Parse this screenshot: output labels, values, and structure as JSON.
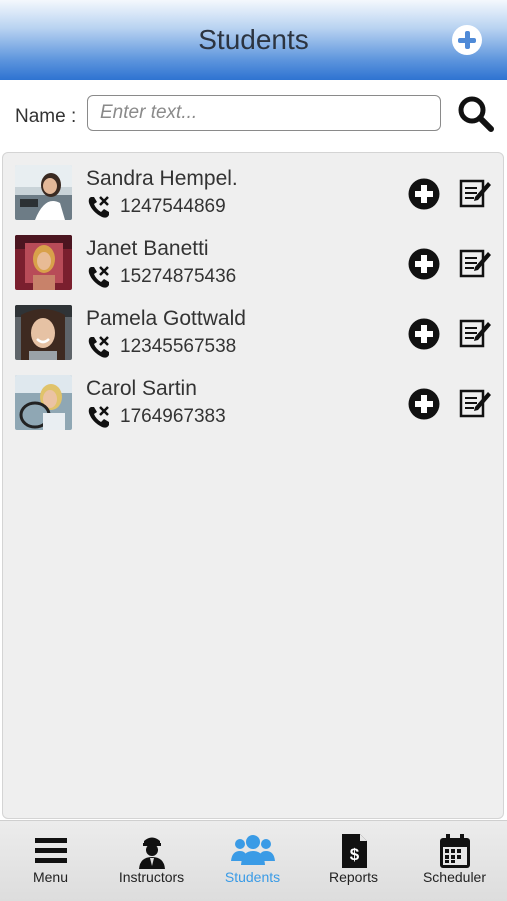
{
  "header": {
    "title": "Students",
    "add_icon": "plus-circle-icon"
  },
  "search": {
    "label": "Name :",
    "placeholder": "Enter text...",
    "value": "",
    "icon": "search-icon"
  },
  "students": [
    {
      "name": "Sandra Hempel.",
      "phone": "1247544869"
    },
    {
      "name": "Janet Banetti",
      "phone": "15274875436"
    },
    {
      "name": "Pamela Gottwald",
      "phone": "12345567538"
    },
    {
      "name": "Carol Sartin",
      "phone": "1764967383"
    }
  ],
  "tabs": [
    {
      "label": "Menu",
      "icon": "hamburger-menu-icon",
      "active": false
    },
    {
      "label": "Instructors",
      "icon": "instructor-icon",
      "active": false
    },
    {
      "label": "Students",
      "icon": "students-group-icon",
      "active": true
    },
    {
      "label": "Reports",
      "icon": "report-document-icon",
      "active": false
    },
    {
      "label": "Scheduler",
      "icon": "calendar-icon",
      "active": false
    }
  ],
  "colors": {
    "accent": "#3a9be6",
    "header_dark": "#2e73d1",
    "text": "#333333"
  }
}
